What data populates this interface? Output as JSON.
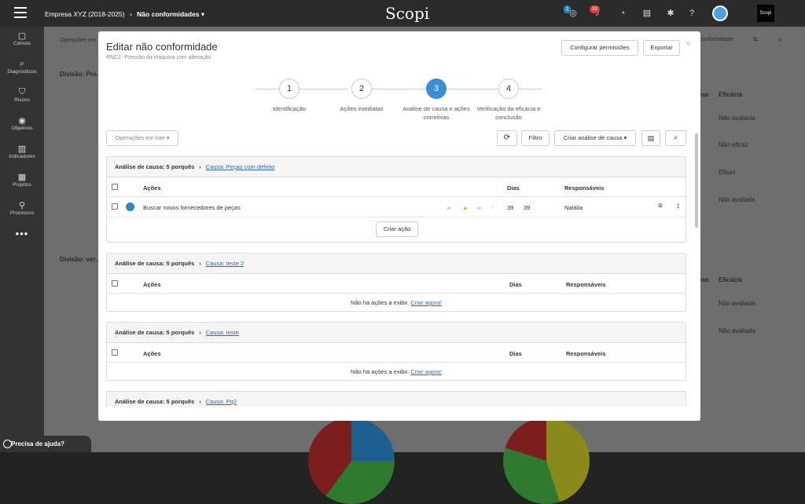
{
  "topbar": {
    "company": "Empresa XYZ (2018-2025)",
    "section": "Não conformidades",
    "logo": "Scopi",
    "badge_blue": "1",
    "badge_red": "33",
    "brand": "Scopi"
  },
  "sidebar": {
    "items": [
      {
        "label": "Canvas",
        "icon": "canvas-icon"
      },
      {
        "label": "Diagnósticos",
        "icon": "search-icon"
      },
      {
        "label": "Riscos",
        "icon": "shield-icon"
      },
      {
        "label": "Objetivos",
        "icon": "target-icon"
      },
      {
        "label": "Indicadores",
        "icon": "bar-chart-icon"
      },
      {
        "label": "Projetos",
        "icon": "projects-icon"
      },
      {
        "label": "Processos",
        "icon": "flowchart-icon"
      }
    ],
    "more": "•••"
  },
  "background": {
    "ops": "Operações em...",
    "division1": "Divisão: Pro...",
    "division2": "Divisão: ver...",
    "col_eficacia": "Eficácia",
    "col_ativas": "ivas",
    "filter_label": "conformidade",
    "statuses": [
      "Não avaliada",
      "Não eficaz",
      "Eficaz",
      "Não avaliada",
      "Não avaliada",
      "Não avaliada"
    ]
  },
  "help": {
    "label": "Precisa de ajuda?"
  },
  "modal": {
    "title": "Editar não conformidade",
    "subtitle": "RNC1 -Pressão da maquina com alteração",
    "btn_permissions": "Configurar permissões",
    "btn_export": "Exportar",
    "close": "×",
    "steps": [
      {
        "num": "1",
        "label": "Identificação",
        "active": false
      },
      {
        "num": "2",
        "label": "Ações imediatas",
        "active": false
      },
      {
        "num": "3",
        "label": "Análise de causa e ações corretivas",
        "active": true
      },
      {
        "num": "4",
        "label": "Verificação da eficácia e conclusão",
        "active": false
      }
    ],
    "toolbar": {
      "batch": "Operações em lote ▾",
      "filter": "Filtro",
      "create_analysis": "Criar análise de causa ▾"
    },
    "cards": [
      {
        "type_label": "Análise de causa: 5 porquês",
        "cause": "Causa: Peças com defeito",
        "headers": {
          "actions": "Ações",
          "days": "Dias",
          "responsible": "Responsáveis"
        },
        "rows": [
          {
            "action": "Buscar novos fornecedores de peças",
            "days1": "39",
            "days2": "39",
            "responsible": "Natália",
            "status_color": "#2e86c9"
          }
        ],
        "create_action": "Criar ação"
      },
      {
        "type_label": "Análise de causa: 5 porquês",
        "cause": "Causa: teste 2",
        "headers": {
          "actions": "Ações",
          "days": "Dias",
          "responsible": "Responsáveis"
        },
        "empty": "Não há ações a exibir.",
        "empty_link": "Criar agora!"
      },
      {
        "type_label": "Análise de causa: 5 porquês",
        "cause": "Causa: teste",
        "headers": {
          "actions": "Ações",
          "days": "Dias",
          "responsible": "Responsáveis"
        },
        "empty": "Não há ações a exibir.",
        "empty_link": "Criar agora!"
      },
      {
        "type_label": "Análise de causa: 5 porquês",
        "cause": "Causa: Pq2"
      }
    ]
  },
  "colors": {
    "accent": "#3b8ed0",
    "badge_red": "#e23c3c",
    "badge_blue": "#2e86c9",
    "warning": "#f0a030"
  }
}
